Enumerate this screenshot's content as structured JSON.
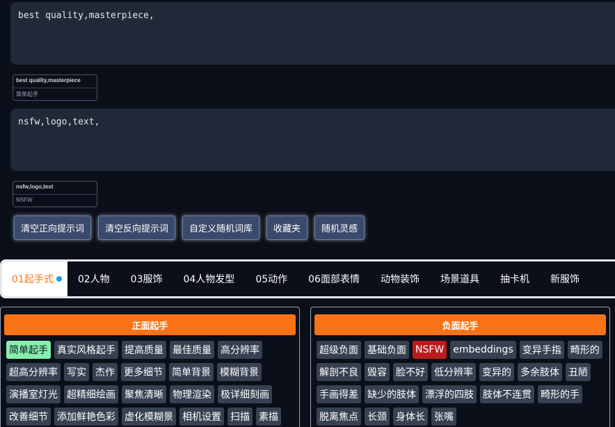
{
  "positive_prompt": {
    "value": "best quality,masterpiece,"
  },
  "positive_card": {
    "text": "best quality,masterpiece",
    "label": "简单起手"
  },
  "negative_prompt": {
    "value": "nsfw,logo,text,"
  },
  "negative_card": {
    "text": "nsfw,logo,text",
    "label": "NSFW"
  },
  "buttons": {
    "clear_positive": "清空正向提示词",
    "clear_negative": "清空反向提示词",
    "custom_random": "自定义随机词库",
    "favorites": "收藏夹",
    "random_inspiration": "随机灵感"
  },
  "tabs": [
    {
      "label": "01起手式",
      "active": true
    },
    {
      "label": "02人物"
    },
    {
      "label": "03服饰"
    },
    {
      "label": "04人物发型"
    },
    {
      "label": "05动作"
    },
    {
      "label": "06面部表情"
    },
    {
      "label": "动物装饰"
    },
    {
      "label": "场景道具"
    },
    {
      "label": "抽卡机"
    },
    {
      "label": "新服饰"
    }
  ],
  "positive_panel": {
    "title": "正面起手",
    "tags": [
      {
        "label": "简单起手",
        "highlight": "green"
      },
      {
        "label": "真实风格起手"
      },
      {
        "label": "提高质量"
      },
      {
        "label": "最佳质量"
      },
      {
        "label": "高分辨率"
      },
      {
        "label": "超高分辨率"
      },
      {
        "label": "写实"
      },
      {
        "label": "杰作"
      },
      {
        "label": "更多细节"
      },
      {
        "label": "简单背景"
      },
      {
        "label": "模糊背景"
      },
      {
        "label": "演播室灯光"
      },
      {
        "label": "超精细绘画"
      },
      {
        "label": "聚焦清晰"
      },
      {
        "label": "物理渲染"
      },
      {
        "label": "极详细刻画"
      },
      {
        "label": "改善细节"
      },
      {
        "label": "添加鲜艳色彩"
      },
      {
        "label": "虚化模糊景"
      },
      {
        "label": "相机设置"
      },
      {
        "label": "扫描"
      },
      {
        "label": "素描"
      }
    ]
  },
  "negative_panel": {
    "title": "负面起手",
    "tags": [
      {
        "label": "超级负面"
      },
      {
        "label": "基础负面"
      },
      {
        "label": "NSFW",
        "highlight": "red"
      },
      {
        "label": "embeddings"
      },
      {
        "label": "变异手指"
      },
      {
        "label": "畸形的"
      },
      {
        "label": "解剖不良"
      },
      {
        "label": "毁容"
      },
      {
        "label": "脸不好"
      },
      {
        "label": "低分辨率"
      },
      {
        "label": "变异的"
      },
      {
        "label": "多余肢体"
      },
      {
        "label": "丑陋"
      },
      {
        "label": "手画得差"
      },
      {
        "label": "缺少的肢体"
      },
      {
        "label": "漂浮的四肢"
      },
      {
        "label": "肢体不连贯"
      },
      {
        "label": "畸形的手"
      },
      {
        "label": "脱离焦点"
      },
      {
        "label": "长颈"
      },
      {
        "label": "身体长"
      },
      {
        "label": "张嘴"
      }
    ]
  }
}
